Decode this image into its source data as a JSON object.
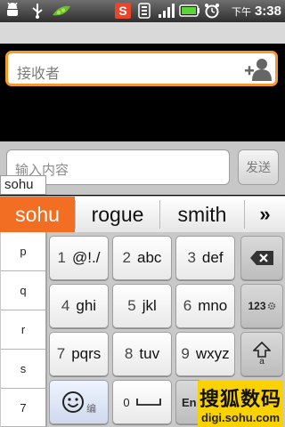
{
  "status_bar": {
    "icons": [
      "usb-debugging-icon",
      "usb-icon",
      "pea-pod-icon",
      "sohu-s-icon",
      "wifi-icon",
      "signal-icon",
      "battery-icon",
      "alarm-icon"
    ],
    "ampm": "下午",
    "time": "3:38",
    "sohu_icon_color": "#e8452b",
    "battery_color": "#5fd33a"
  },
  "recipient": {
    "placeholder": "接收者",
    "add_contact_icon": "add-contact-icon",
    "accent": "#f39a2d"
  },
  "compose": {
    "placeholder": "输入内容",
    "send_label": "发送"
  },
  "ime": {
    "composition": "sohu",
    "candidates": [
      "sohu",
      "rogue",
      "smith"
    ],
    "more_icon": "»",
    "highlight_color": "#f26e22"
  },
  "keyboard": {
    "side_keys": [
      "p",
      "q",
      "r",
      "s",
      "7"
    ],
    "keys": {
      "k1": {
        "num": "1",
        "letters": "@!./"
      },
      "k2": {
        "num": "2",
        "letters": "abc"
      },
      "k3": {
        "num": "3",
        "letters": "def"
      },
      "k4": {
        "num": "4",
        "letters": "ghi"
      },
      "k5": {
        "num": "5",
        "letters": "jkl"
      },
      "k6": {
        "num": "6",
        "letters": "mno"
      },
      "k7": {
        "num": "7",
        "letters": "pqrs"
      },
      "k8": {
        "num": "8",
        "letters": "tuv"
      },
      "k9": {
        "num": "9",
        "letters": "wxyz"
      },
      "k0": {
        "num": "0",
        "letters": ""
      }
    },
    "backspace_icon": "backspace-icon",
    "num_mode_label": "123",
    "shift_sub": "a",
    "emoji_sub": "编",
    "enter_label": "En"
  },
  "watermark": {
    "title": "搜狐数码",
    "url": "digi.sohu.com"
  }
}
